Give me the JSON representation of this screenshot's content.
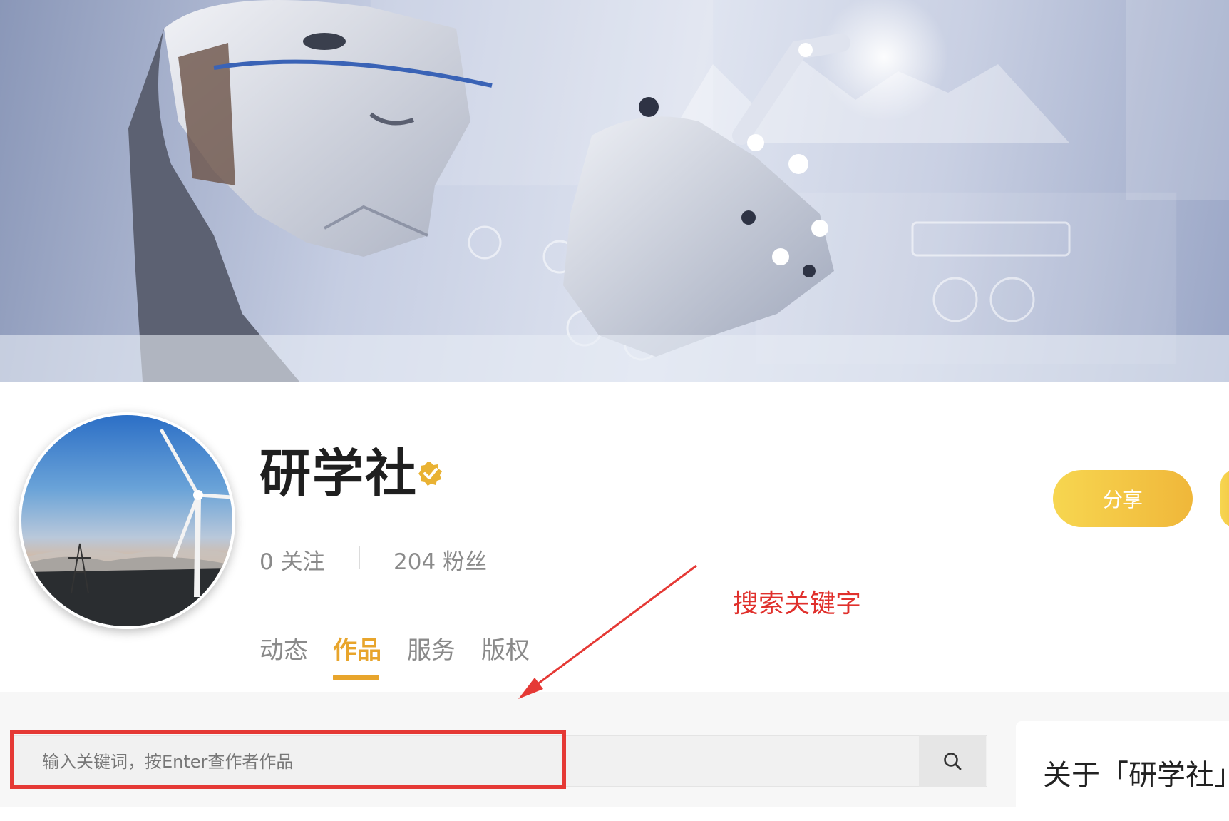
{
  "banner": {
    "image": "robot-hud-banner"
  },
  "profile": {
    "name": "研学社",
    "verified_icon": "verified-badge-icon",
    "following_count": "0",
    "following_label": "关注",
    "followers_count": "204",
    "followers_label": "粉丝"
  },
  "tabs": [
    {
      "label": "动态",
      "active": false
    },
    {
      "label": "作品",
      "active": true
    },
    {
      "label": "服务",
      "active": false
    },
    {
      "label": "版权",
      "active": false
    }
  ],
  "actions": {
    "share_label": "分享"
  },
  "annotation": {
    "text": "搜索关键字"
  },
  "search": {
    "placeholder": "输入关键词，按Enter查作者作品",
    "icon": "search-icon"
  },
  "about": {
    "title": "关于「研学社」"
  },
  "colors": {
    "accent": "#e8a52c",
    "annotation_red": "#e53935",
    "share_gradient_start": "#f7d650",
    "share_gradient_end": "#f0b73a"
  }
}
